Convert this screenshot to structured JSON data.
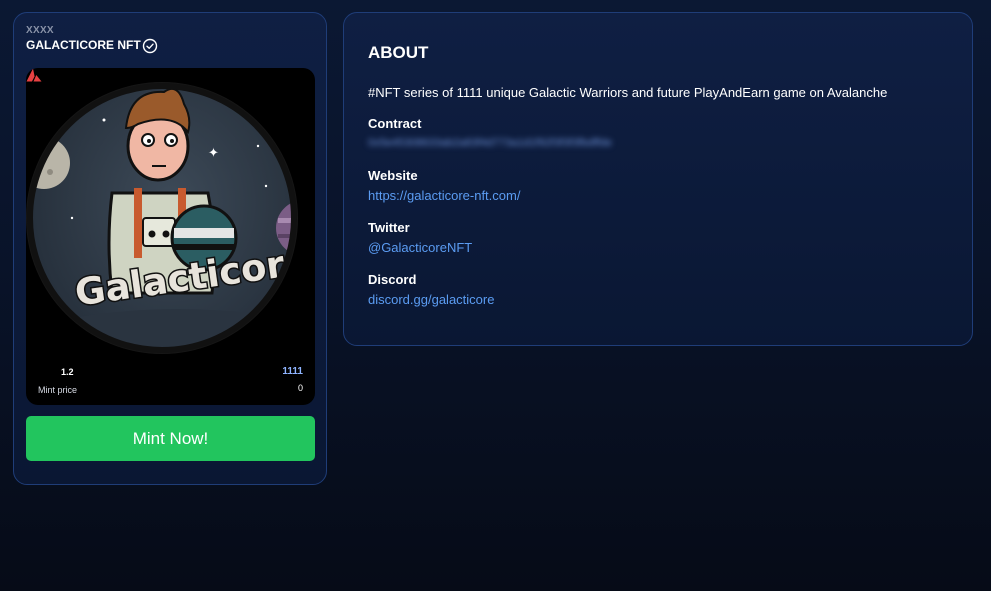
{
  "collection": {
    "code": "XXXX",
    "name": "GALACTICORE NFT",
    "verified_icon": "check-circle-icon",
    "image_caption": "Galacticore",
    "mint_price": "1.2",
    "mint_price_label": "Mint price",
    "currency_icon": "avalanche-icon",
    "supply": "1111",
    "minted": "0",
    "mint_button": "Mint Now!"
  },
  "about": {
    "title": "ABOUT",
    "description": "#NFT series of 1111 unique Galactic Warriors and future PlayAndEarn game on Avalanche",
    "contract_label": "Contract",
    "contract_value": "0x5e45308633ab2a83f4d773a1d1f92f3f3f3fbdffde",
    "website_label": "Website",
    "website_value": "https://galacticore-nft.com/",
    "twitter_label": "Twitter",
    "twitter_value": "@GalacticoreNFT",
    "discord_label": "Discord",
    "discord_value": "discord.gg/galacticore"
  },
  "colors": {
    "accent_green": "#22c55e",
    "link_blue": "#5b9cf2",
    "card_border": "#1f3d78",
    "avalanche_red": "#e84142"
  }
}
